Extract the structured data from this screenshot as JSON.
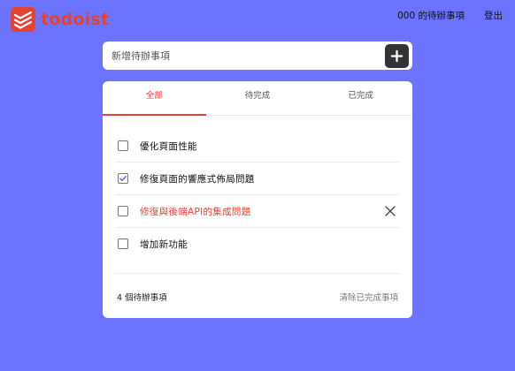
{
  "brand": {
    "name": "todoist",
    "color": "#e44332"
  },
  "header": {
    "user_todo_label": "000 的待辦事項",
    "logout_label": "登出"
  },
  "new_todo": {
    "placeholder": "新增待辦事項",
    "add_icon": "plus-icon"
  },
  "tabs": [
    {
      "label": "全部",
      "active": true
    },
    {
      "label": "待完成",
      "active": false
    },
    {
      "label": "已完成",
      "active": false
    }
  ],
  "todos": [
    {
      "label": "優化頁面性能",
      "completed": false
    },
    {
      "label": "修復頁面的響應式佈局問題",
      "completed": true
    },
    {
      "label": "修復與後端API的集成問題",
      "completed": false,
      "hovered": true
    },
    {
      "label": "增加新功能",
      "completed": false
    }
  ],
  "footer": {
    "count_label": "4 個待辦事項",
    "clear_label": "清除已完成事項"
  },
  "colors": {
    "background": "#6c74ff",
    "accent": "#e44332",
    "check": "#4a64d8"
  }
}
